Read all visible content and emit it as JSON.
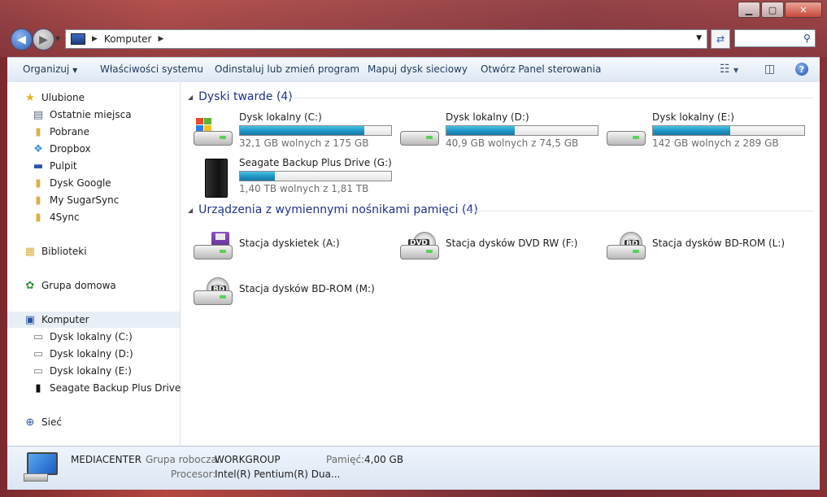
{
  "address": {
    "segment": "Komputer",
    "search_value": ""
  },
  "commands": {
    "organize": "Organizuj",
    "system_properties": "Właściwości systemu",
    "uninstall": "Odinstaluj lub zmień program",
    "map_drive": "Mapuj dysk sieciowy",
    "control_panel": "Otwórz Panel sterowania"
  },
  "nav": {
    "favorites": "Ulubione",
    "fav_items": [
      "Ostatnie miejsca",
      "Pobrane",
      "Dropbox",
      "Pulpit",
      "Dysk Google",
      "My SugarSync",
      "4Sync"
    ],
    "libraries": "Biblioteki",
    "homegroup": "Grupa domowa",
    "computer": "Komputer",
    "computer_items": [
      "Dysk lokalny (C:)",
      "Dysk lokalny (D:)",
      "Dysk lokalny (E:)",
      "Seagate Backup Plus Drive (G:)"
    ],
    "network": "Sieć"
  },
  "groups": {
    "hdd": "Dyski twarde (4)",
    "removable": "Urządzenia z wymiennymi nośnikami pamięci (4)"
  },
  "drives": [
    {
      "name": "Dysk lokalny (C:)",
      "info": "32,1 GB wolnych z 175 GB",
      "used_fraction": 0.82
    },
    {
      "name": "Dysk lokalny (D:)",
      "info": "40,9 GB wolnych z 74,5 GB",
      "used_fraction": 0.45
    },
    {
      "name": "Dysk lokalny (E:)",
      "info": "142 GB wolnych z 289 GB",
      "used_fraction": 0.51
    },
    {
      "name": "Seagate Backup Plus Drive (G:)",
      "info": "1,40 TB wolnych z 1,81 TB",
      "used_fraction": 0.23
    }
  ],
  "removable": [
    {
      "name": "Stacja dyskietek (A:)"
    },
    {
      "name": "Stacja dysków DVD RW (F:)",
      "tag": "DVD"
    },
    {
      "name": "Stacja dysków BD-ROM (L:)",
      "tag": "BD"
    },
    {
      "name": "Stacja dysków BD-ROM (M:)",
      "tag": "BD"
    }
  ],
  "details": {
    "computer_name": "MEDIACENTER",
    "workgroup_label": "Grupa robocza:",
    "workgroup_value": "WORKGROUP",
    "memory_label": "Pamięć:",
    "memory_value": "4,00 GB",
    "cpu_label": "Procesor:",
    "cpu_value": "Intel(R) Pentium(R) Dua..."
  },
  "colors": {
    "accent": "#1e3287",
    "bar": "#1d8fc0"
  }
}
